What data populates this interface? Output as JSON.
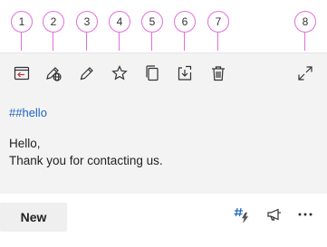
{
  "callouts": [
    "1",
    "2",
    "3",
    "4",
    "5",
    "6",
    "7",
    "8"
  ],
  "toolbar": {
    "icons": [
      "insert-message-icon",
      "edit-web-icon",
      "pencil-edit-icon",
      "favorite-star-icon",
      "copy-icon",
      "download-to-tray-icon",
      "delete-trash-icon",
      "expand-icon"
    ]
  },
  "message": {
    "hashtag": "##hello",
    "lines": [
      "Hello,",
      "Thank you for contacting us."
    ]
  },
  "bottom_bar": {
    "new_label": "New",
    "icons": [
      "hashtag-lightning-icon",
      "megaphone-icon",
      "more-options-icon"
    ]
  },
  "colors": {
    "callout_accent": "#e070d8",
    "link_blue": "#1a66c2",
    "panel_background": "#f3f3f3",
    "lightning_accent": "#1a66c2"
  }
}
